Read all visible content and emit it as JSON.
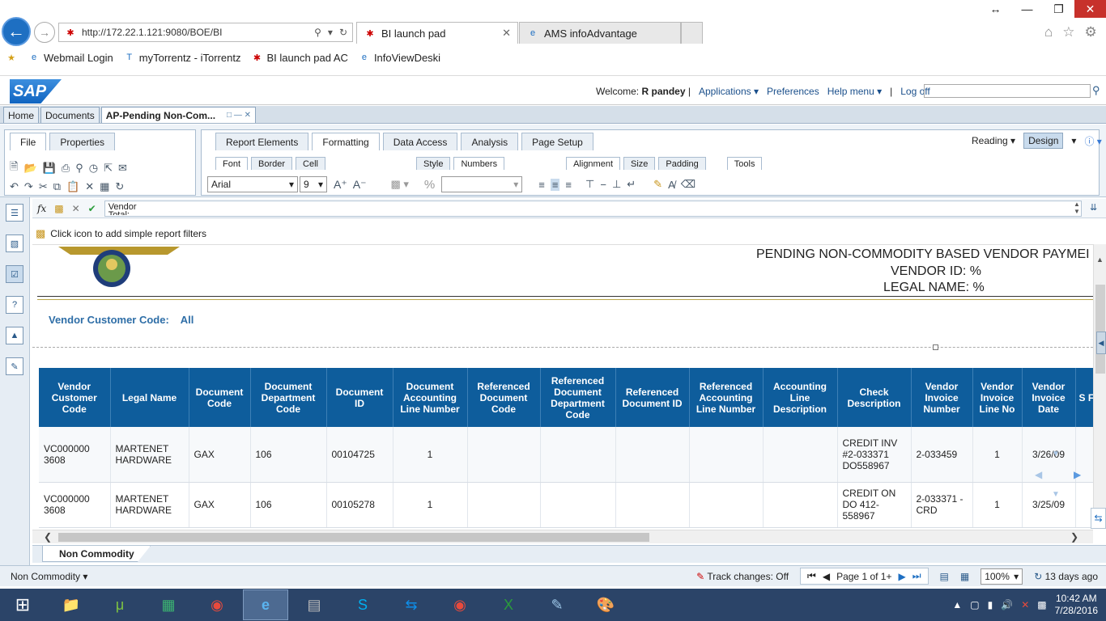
{
  "browser": {
    "url": "http://172.22.1.121:9080/BOE/BI",
    "tabs": [
      {
        "label": "BI launch pad"
      },
      {
        "label": "AMS infoAdvantage"
      }
    ],
    "favorites": [
      "Webmail Login",
      "myTorrentz - iTorrentz",
      "BI launch pad AC",
      "InfoViewDeski"
    ]
  },
  "sap": {
    "logo": "SAP",
    "welcome_label": "Welcome:",
    "user": "R pandey",
    "menu": [
      "Applications",
      "Preferences",
      "Help menu",
      "Log off"
    ],
    "doc_tabs": [
      "Home",
      "Documents",
      "AP-Pending Non-Com..."
    ]
  },
  "toolbar": {
    "left_tabs": [
      "File",
      "Properties"
    ],
    "main_tabs": [
      "Report Elements",
      "Formatting",
      "Data Access",
      "Analysis",
      "Page Setup"
    ],
    "reading": "Reading",
    "design": "Design",
    "sub_tabs": [
      "Font",
      "Border",
      "Cell",
      "Style",
      "Numbers",
      "Alignment",
      "Size",
      "Padding",
      "Tools"
    ],
    "font_name": "Arial",
    "font_size": "9"
  },
  "formula": {
    "value": "Vendor",
    "value2": "Total:"
  },
  "filter_hint": "Click icon to add simple report filters",
  "report": {
    "title": "PENDING NON-COMMODITY BASED VENDOR PAYMEI",
    "vendor_id": "VENDOR ID: %",
    "legal_name": "LEGAL NAME: %",
    "vcc_label": "Vendor Customer Code:",
    "vcc_value": "All",
    "columns": [
      "Vendor Customer Code",
      "Legal Name",
      "Document Code",
      "Document Department Code",
      "Document ID",
      "Document Accounting Line Number",
      "Referenced Document Code",
      "Referenced Document Department Code",
      "Referenced Document ID",
      "Referenced Accounting Line Number",
      "Accounting Line Description",
      "Check Description",
      "Vendor Invoice Number",
      "Vendor Invoice Line No",
      "Vendor Invoice Date",
      "S F"
    ],
    "rows": [
      [
        "VC000000 3608",
        "MARTENET HARDWARE",
        "GAX",
        "106",
        "00104725",
        "1",
        "",
        "",
        "",
        "",
        "",
        "CREDIT INV #2-033371 DO558967",
        "2-033459",
        "1",
        "3/26/09",
        ""
      ],
      [
        "VC000000 3608",
        "MARTENET HARDWARE",
        "GAX",
        "106",
        "00105278",
        "1",
        "",
        "",
        "",
        "",
        "",
        "CREDIT ON DO 412-558967",
        "2-033371 -CRD",
        "1",
        "3/25/09",
        ""
      ]
    ]
  },
  "sheet_tab": "Non Commodity",
  "status": {
    "sheet": "Non Commodity",
    "track_changes": "Track changes: Off",
    "page": "Page 1 of 1+",
    "zoom": "100%",
    "refresh": "13 days ago"
  },
  "taskbar": {
    "time": "10:42 AM",
    "date": "7/28/2016"
  }
}
